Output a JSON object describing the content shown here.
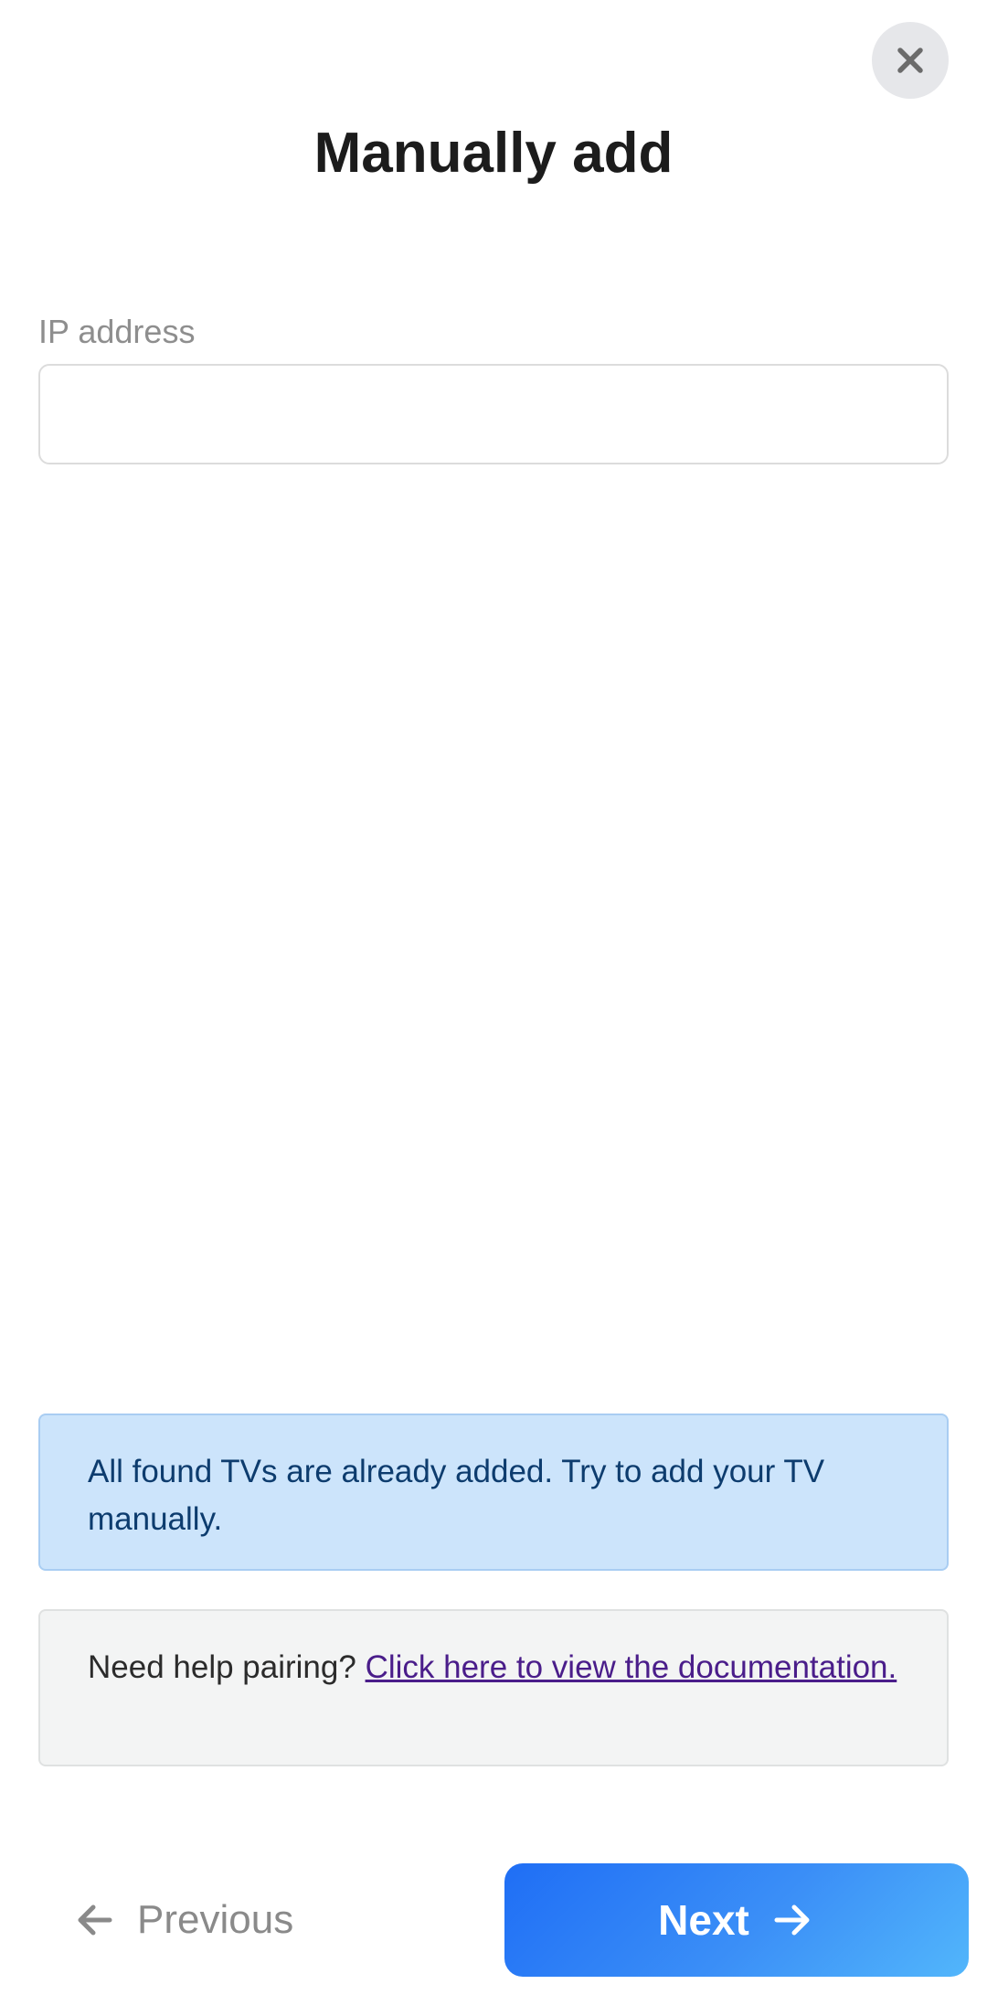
{
  "dialog": {
    "title": "Manually add",
    "close_icon": "close-icon"
  },
  "form": {
    "ip_label": "IP address",
    "ip_value": "",
    "ip_placeholder": ""
  },
  "info": {
    "message": "All found TVs are already added. Try to add your TV manually."
  },
  "help": {
    "prefix": "Need help pairing? ",
    "link_text": "Click here to view the documentation."
  },
  "footer": {
    "previous_label": "Previous",
    "previous_icon": "arrow-left-icon",
    "next_label": "Next",
    "next_icon": "arrow-right-icon"
  },
  "colors": {
    "accent": "#1f6ef5",
    "info_bg": "#cce4fb",
    "info_text": "#0d3c6e",
    "help_bg": "#f3f4f4",
    "link": "#4a1d8a"
  }
}
